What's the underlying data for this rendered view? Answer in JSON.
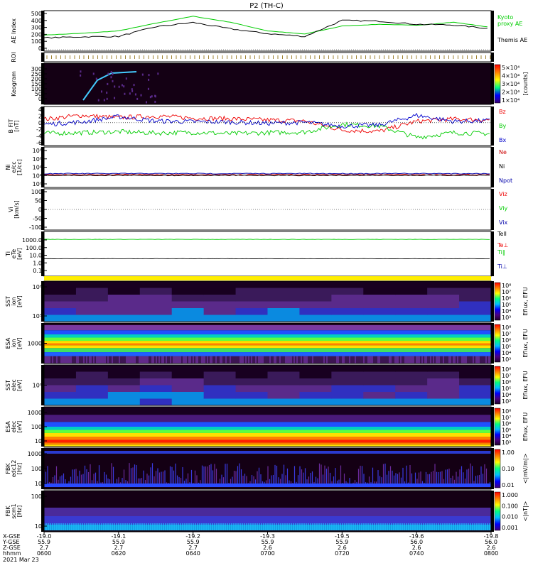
{
  "title": "P2 (TH-C)",
  "date_label": "2021 Mar 23",
  "colors": {
    "ae_index": "#000000",
    "ae_proxy": "#00cc00",
    "bx": "#0000cc",
    "by": "#00cc00",
    "bz": "#ee0000",
    "ne": "#cc0000",
    "ni": "#000000",
    "npot": "#0000aa",
    "vx": "#0000aa",
    "vy": "#00cc00",
    "vz": "#ee0000",
    "tpar": "#000000",
    "tperp_e": "#ee0000",
    "ti": "#00cc00",
    "tperp_i": "#0000aa",
    "roi_bar": "#ffee00",
    "spectro_bg": "#140014"
  },
  "chart_data": [
    {
      "type": "line",
      "panel": "ae",
      "ylabel": "AE Index",
      "yticks": [
        "500",
        "400",
        "300",
        "200",
        "100",
        "0"
      ],
      "ylim": [
        0,
        520
      ],
      "x": [
        0,
        10,
        20,
        30,
        40,
        50,
        60,
        70,
        80,
        90,
        100,
        110,
        120
      ],
      "series": [
        {
          "name": "Kyoto proxy AE",
          "values": [
            210,
            235,
            270,
            380,
            480,
            395,
            270,
            225,
            340,
            365,
            350,
            395,
            320
          ]
        },
        {
          "name": "Themis AE",
          "values": [
            170,
            185,
            190,
            330,
            390,
            300,
            230,
            190,
            420,
            410,
            365,
            355,
            300
          ]
        }
      ],
      "legend": [
        "Kyoto",
        "proxy AE",
        "Themis AE"
      ]
    },
    {
      "type": "table",
      "panel": "roi",
      "ylabel": "ROI"
    },
    {
      "type": "heatmap",
      "panel": "keogram",
      "ylabel": "Keogram",
      "yticks": [
        "300",
        "250",
        "200",
        "150",
        "100",
        "50",
        "0"
      ],
      "colorbar_ticks": [
        "5×10⁴",
        "4×10⁴",
        "3×10⁴",
        "2×10⁴",
        "1×10⁴"
      ],
      "colorbar_label": "[counts]"
    },
    {
      "type": "line",
      "panel": "bfit",
      "ylabel": "B FIT",
      "ylabel2": "[nT]",
      "yticks": [
        "4",
        "2",
        "0",
        "-2",
        "-4",
        "-6"
      ],
      "ylim": [
        -6,
        4
      ],
      "x": [
        0,
        10,
        20,
        30,
        40,
        50,
        60,
        70,
        80,
        90,
        100,
        110,
        120
      ],
      "series": [
        {
          "name": "Bz",
          "values": [
            1.0,
            2.2,
            1.5,
            2.0,
            1.4,
            1.2,
            0.8,
            0.5,
            -2.2,
            -2.6,
            0.4,
            1.1,
            0.8
          ]
        },
        {
          "name": "By",
          "values": [
            -3.2,
            -3.0,
            -2.7,
            -3.1,
            -2.9,
            -3.3,
            -3.0,
            -2.8,
            -0.5,
            -1.0,
            -4.4,
            -3.0,
            -3.3
          ]
        },
        {
          "name": "Bx",
          "values": [
            -0.5,
            0.2,
            1.8,
            0.5,
            0.3,
            0.2,
            -0.2,
            0.1,
            -1.0,
            -0.7,
            2.2,
            0.4,
            0.6
          ]
        }
      ]
    },
    {
      "type": "line",
      "panel": "ni",
      "ylabel": "Ni",
      "ylabel2": "e/cc",
      "ylabel3": "[1/cc]",
      "yticks": [
        "10⁸",
        "10⁶",
        "10⁴",
        "10²",
        "10⁰"
      ],
      "legend": [
        "Ne",
        "Ni",
        "Npot"
      ]
    },
    {
      "type": "line",
      "panel": "vi",
      "ylabel": "Vi",
      "ylabel2": "[km/s]",
      "yticks": [
        "100",
        "50",
        "0",
        "-50",
        "-100"
      ],
      "ylim": [
        -100,
        100
      ],
      "legend": [
        "Viz",
        "Viy",
        "Vix"
      ]
    },
    {
      "type": "line",
      "panel": "t",
      "ylabel": "Ti",
      "ylabel2": "eTe",
      "ylabel3": "[eV]",
      "yticks": [
        "1000.0",
        "100.0",
        "10.0",
        "1.0",
        "0.1"
      ],
      "ylim": [
        0.1,
        3000
      ],
      "x": [
        0,
        30,
        60,
        90,
        120
      ],
      "series": [
        {
          "name": "Tell",
          "values": [
            3.5,
            3.6,
            3.4,
            3.5,
            3.5
          ]
        },
        {
          "name": "Ti",
          "values": [
            1200,
            1150,
            1250,
            1200,
            1180
          ]
        }
      ],
      "legend": [
        "Tell",
        "Te⊥",
        "Ti∥",
        "Ti⊥"
      ]
    },
    {
      "type": "heatmap",
      "panel": "sst_e",
      "ylabel": "SST",
      "ylabel2": "ion",
      "ylabel3": "[eV]",
      "yticks": [
        "10⁶",
        "10⁵"
      ],
      "colorbar_ticks": [
        "10⁸",
        "10⁷",
        "10⁶",
        "10⁵",
        "10⁴",
        "10³"
      ],
      "colorbar_label": "Eflux, EFU"
    },
    {
      "type": "heatmap",
      "panel": "esa_i",
      "ylabel": "ESA",
      "ylabel2": "ion",
      "ylabel3": "[eV]",
      "yticks": [
        "1000"
      ],
      "colorbar_ticks": [
        "10⁸",
        "10⁷",
        "10⁶",
        "10⁵",
        "10⁴",
        "10³"
      ],
      "colorbar_label": "Eflux, EFU"
    },
    {
      "type": "heatmap",
      "panel": "sst_el",
      "ylabel": "SST",
      "ylabel2": "elec",
      "ylabel3": "[eV]",
      "yticks": [
        "10⁵"
      ],
      "colorbar_ticks": [
        "10⁸",
        "10⁷",
        "10⁶",
        "10⁵",
        "10⁴",
        "10³"
      ],
      "colorbar_label": "Eflux, EFU"
    },
    {
      "type": "heatmap",
      "panel": "esa_el",
      "ylabel": "ESA",
      "ylabel2": "elec",
      "ylabel3": "[eV]",
      "yticks": [
        "1000",
        "100",
        "10"
      ],
      "colorbar_ticks": [
        "10⁸",
        "10⁷",
        "10⁶",
        "10⁵",
        "10⁴",
        "10³"
      ],
      "colorbar_label": "Eflux, EFU"
    },
    {
      "type": "heatmap",
      "panel": "fbk_e",
      "ylabel": "FBK",
      "ylabel2": "edc12",
      "ylabel3": "[Hz]",
      "yticks": [
        "1000",
        "100",
        "10"
      ],
      "colorbar_ticks": [
        "1.00",
        "0.10",
        "0.01"
      ],
      "colorbar_label": "<|mV/m|>"
    },
    {
      "type": "heatmap",
      "panel": "fbk_b",
      "ylabel": "FBK",
      "ylabel2": "scm1",
      "ylabel3": "[Hz]",
      "yticks": [
        "100",
        "10"
      ],
      "colorbar_ticks": [
        "1.000",
        "0.100",
        "0.010",
        "0.001"
      ],
      "colorbar_label": "<|nT|>"
    }
  ],
  "x_axis": {
    "row_labels": [
      "X-GSE",
      "Y-GSE",
      "Z-GSE",
      "hhmm",
      "2021 Mar 23"
    ],
    "columns": [
      {
        "x": "-19.0",
        "y": "55.9",
        "z": "2.7",
        "t": "0600"
      },
      {
        "x": "-19.1",
        "y": "55.9",
        "z": "2.7",
        "t": "0620"
      },
      {
        "x": "-19.2",
        "y": "55.9",
        "z": "2.7",
        "t": "0640"
      },
      {
        "x": "-19.3",
        "y": "55.9",
        "z": "2.6",
        "t": "0700"
      },
      {
        "x": "-19.5",
        "y": "55.9",
        "z": "2.6",
        "t": "0720"
      },
      {
        "x": "-19.6",
        "y": "56.0",
        "z": "2.6",
        "t": "0740"
      },
      {
        "x": "-19.8",
        "y": "56.0",
        "z": "2.6",
        "t": "0800"
      }
    ]
  }
}
